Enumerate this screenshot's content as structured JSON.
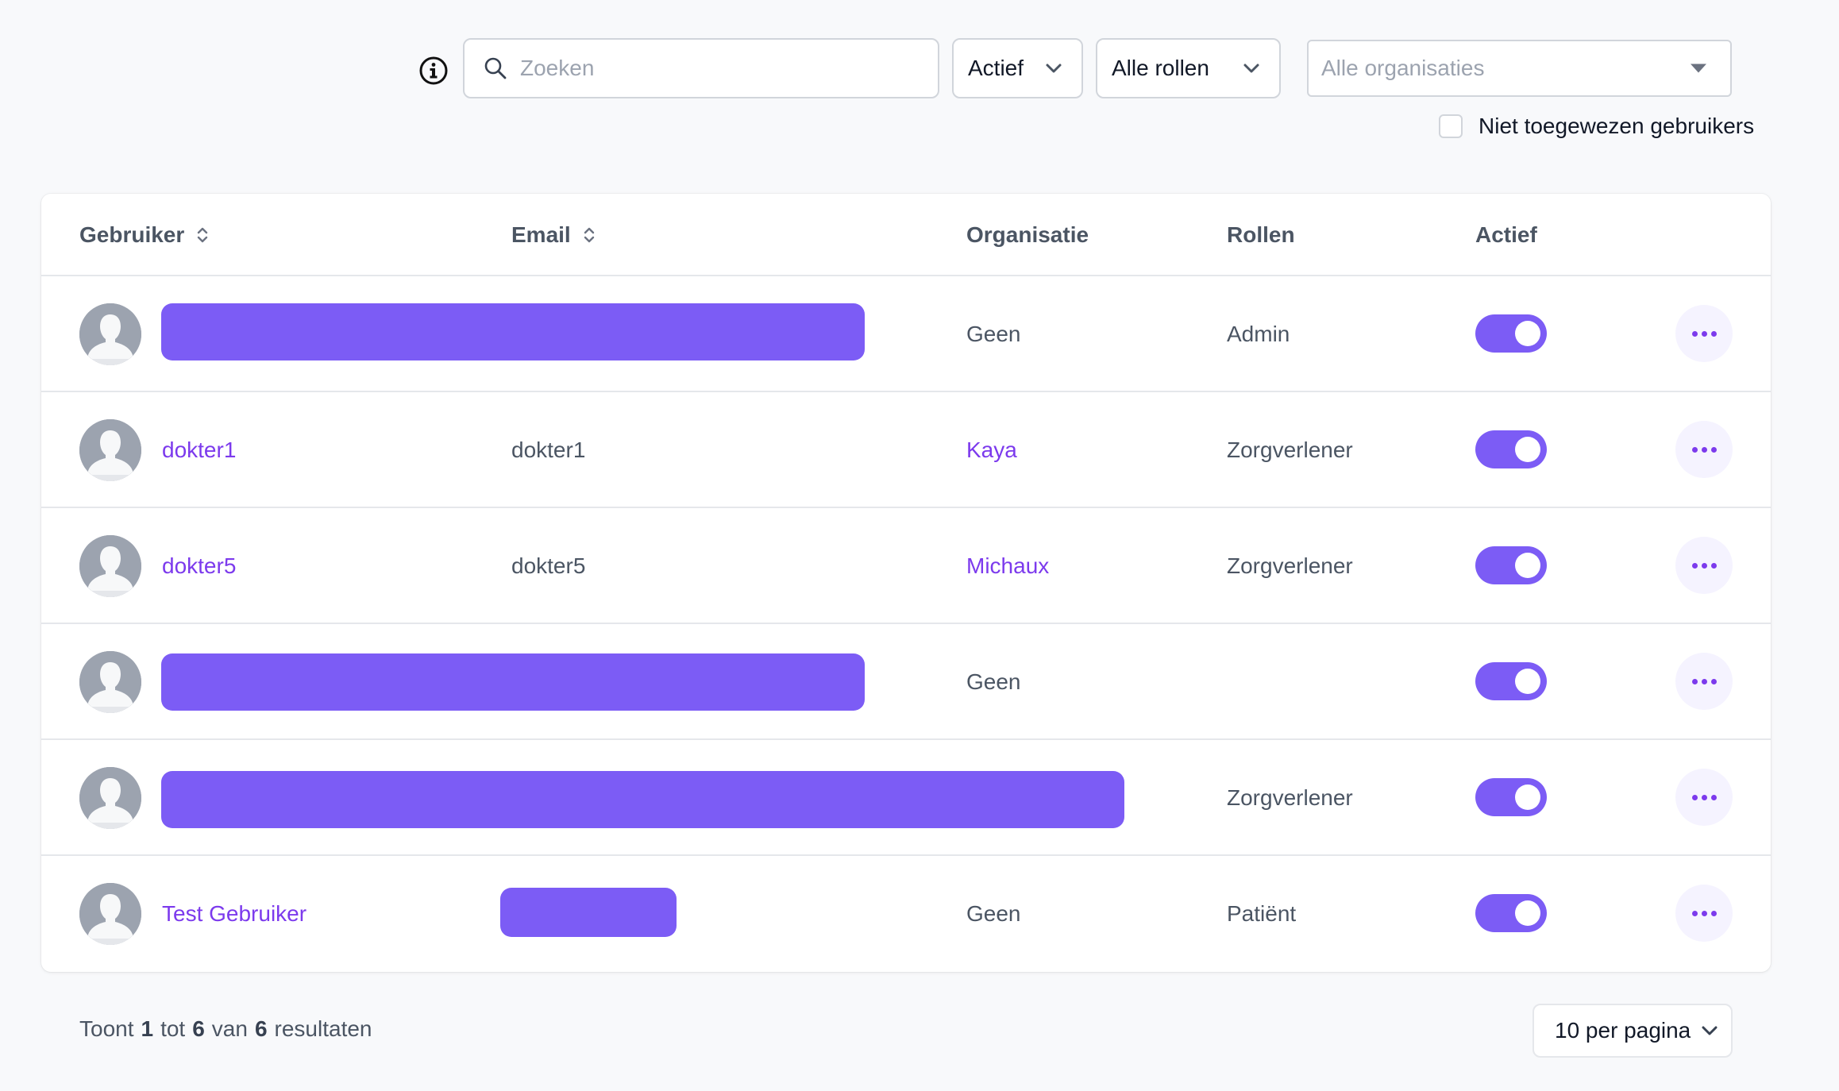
{
  "filters": {
    "search_placeholder": "Zoeken",
    "status_value": "Actief",
    "roles_value": "Alle rollen",
    "organisation_placeholder": "Alle organisaties",
    "unassigned_label": "Niet toegewezen gebruikers",
    "unassigned_checked": false
  },
  "table": {
    "headers": {
      "user": "Gebruiker",
      "email": "Email",
      "organisation": "Organisatie",
      "roles": "Rollen",
      "active": "Actief"
    },
    "rows": [
      {
        "name": "",
        "email": "",
        "organisation": "Geen",
        "role": "Admin",
        "active": true
      },
      {
        "name": "dokter1",
        "email": "dokter1",
        "organisation": "Kaya",
        "role": "Zorgverlener",
        "active": true
      },
      {
        "name": "dokter5",
        "email": "dokter5",
        "organisation": "Michaux",
        "role": "Zorgverlener",
        "active": true
      },
      {
        "name": "",
        "email": "",
        "organisation": "Geen",
        "role": "",
        "active": true
      },
      {
        "name": "",
        "email": "",
        "organisation": "",
        "role": "Zorgverlener",
        "active": true
      },
      {
        "name": "Test Gebruiker",
        "email": "",
        "organisation": "Geen",
        "role": "Patiënt",
        "active": true
      }
    ]
  },
  "footer": {
    "summary_prefix": "Toont",
    "from": "1",
    "tot": "tot",
    "to": "6",
    "van": "van",
    "total": "6",
    "suffix": "resultaten",
    "per_page": "10 per pagina"
  },
  "colors": {
    "accent": "#7c5cf5",
    "link": "#7c3aed",
    "border": "#e5e7eb"
  }
}
